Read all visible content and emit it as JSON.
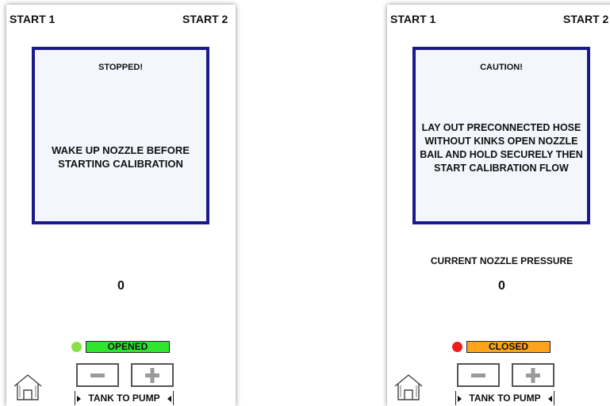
{
  "panels": [
    {
      "start_1": "START 1",
      "start_2": "START 2",
      "message_title": "STOPPED!",
      "message_body": "WAKE UP NOZZLE BEFORE STARTING CALIBRATION",
      "pressure_label": "",
      "pressure_value": "0",
      "status_text": "OPENED",
      "status_color": "#2ee62e",
      "status_dot_color": "#88e04a",
      "tank_label": "TANK TO PUMP",
      "home_icon": "home-icon",
      "minus_icon": "minus-icon",
      "plus_icon": "plus-icon"
    },
    {
      "start_1": "START 1",
      "start_2": "START 2",
      "message_title": "CAUTION!",
      "message_body": "LAY OUT PRECONNECTED HOSE WITHOUT KINKS OPEN NOZZLE BAIL AND HOLD SECURELY THEN START CALIBRATION FLOW",
      "pressure_label": "CURRENT NOZZLE PRESSURE",
      "pressure_value": "0",
      "status_text": "CLOSED",
      "status_color": "#ffa31a",
      "status_dot_color": "#ee1c1c",
      "tank_label": "TANK TO PUMP",
      "home_icon": "home-icon",
      "minus_icon": "minus-icon",
      "plus_icon": "plus-icon"
    }
  ],
  "colors": {
    "message_border": "#1a1a8c",
    "message_background": "#f3f6fc",
    "button_icon_gray": "#9a9a9a"
  }
}
